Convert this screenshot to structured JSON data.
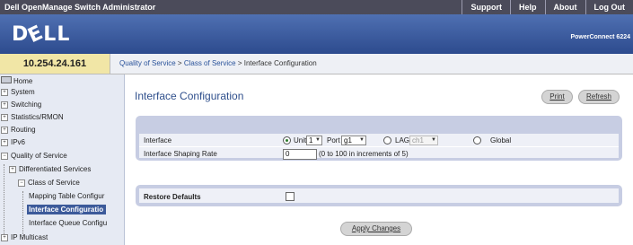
{
  "topbar": {
    "title": "Dell OpenManage Switch Administrator",
    "links": [
      "Support",
      "Help",
      "About",
      "Log Out"
    ]
  },
  "header": {
    "logo": "DELL",
    "product": "PowerConnect 6224"
  },
  "ip": "10.254.24.161",
  "breadcrumb": {
    "items": [
      "Quality of Service",
      "Class of Service",
      "Interface Configuration"
    ],
    "sep": " > "
  },
  "sidebar": {
    "items": [
      {
        "label": "Home",
        "selected": false
      },
      {
        "label": "System",
        "selected": false
      },
      {
        "label": "Switching",
        "selected": false
      },
      {
        "label": "Statistics/RMON",
        "selected": false
      },
      {
        "label": "Routing",
        "selected": false
      },
      {
        "label": "IPv6",
        "selected": false
      },
      {
        "label": "Quality of Service",
        "selected": false
      },
      {
        "label": "Differentiated Services",
        "selected": false
      },
      {
        "label": "Class of Service",
        "selected": false
      },
      {
        "label": "Mapping Table Configur",
        "selected": false
      },
      {
        "label": "Interface Configuratio",
        "selected": true
      },
      {
        "label": "Interface Queue Configu",
        "selected": false
      },
      {
        "label": "IP Multicast",
        "selected": false
      }
    ]
  },
  "page": {
    "title": "Interface Configuration",
    "print_label": "Print",
    "refresh_label": "Refresh",
    "apply_label": "Apply Changes"
  },
  "form": {
    "interface_label": "Interface",
    "unit_label": "Unit",
    "unit_value": "1",
    "port_label": "Port",
    "port_value": "g1",
    "lag_label": "LAG",
    "lag_value": "ch1",
    "global_label": "Global",
    "selected_scope": "Unit",
    "shaping_label": "Interface Shaping Rate",
    "shaping_value": "0",
    "shaping_hint": "(0 to 100 in increments of 5)",
    "restore_label": "Restore Defaults",
    "restore_checked": false
  },
  "colors": {
    "topbar": "#4b4b5a",
    "header": "#3a5ba0",
    "accent": "#2f4f8c",
    "panel": "#c7cde3"
  }
}
